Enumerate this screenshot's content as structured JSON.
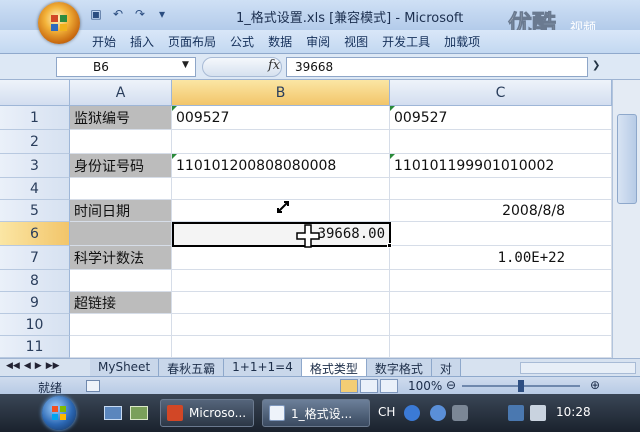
{
  "window": {
    "title": "1_格式设置.xls [兼容模式] - Microsoft",
    "brand_watermark": "优酷",
    "brand_sub": "视频"
  },
  "ribbon": {
    "tabs": [
      "开始",
      "插入",
      "页面布局",
      "公式",
      "数据",
      "审阅",
      "视图",
      "开发工具",
      "加载项"
    ]
  },
  "formula_bar": {
    "name_box": "B6",
    "fx": "fx",
    "value": "39668"
  },
  "grid": {
    "columns": [
      "A",
      "B",
      "C"
    ],
    "rows": [
      "1",
      "2",
      "3",
      "4",
      "5",
      "6",
      "7",
      "8",
      "9",
      "10",
      "11"
    ],
    "cells": {
      "A1": "监狱编号",
      "B1": "009527",
      "C1": "009527",
      "A3": "身份证号码",
      "B3": "110101200808080008",
      "C3": "110101199901010002",
      "A5": "时间日期",
      "C5": "2008/8/8",
      "B6": "39668.00",
      "A7": "科学计数法",
      "C7": "1.00E+22",
      "A9": "超链接"
    },
    "active_cell": "B6"
  },
  "sheets": {
    "tabs": [
      "MySheet",
      "春秋五霸",
      "1+1+1=4",
      "格式类型",
      "数字格式",
      "对"
    ],
    "active": "格式类型"
  },
  "status": {
    "text": "就绪",
    "zoom": "100%",
    "zoom_fraction": 0.5
  },
  "taskbar": {
    "tasks": [
      "Microso...",
      "1_格式设..."
    ],
    "language": "CH",
    "clock": "10:28"
  },
  "colors": {
    "label_fill": "#bcbcbc",
    "header_active": "#f2c56a",
    "accent_green": "#2a8a3a"
  }
}
